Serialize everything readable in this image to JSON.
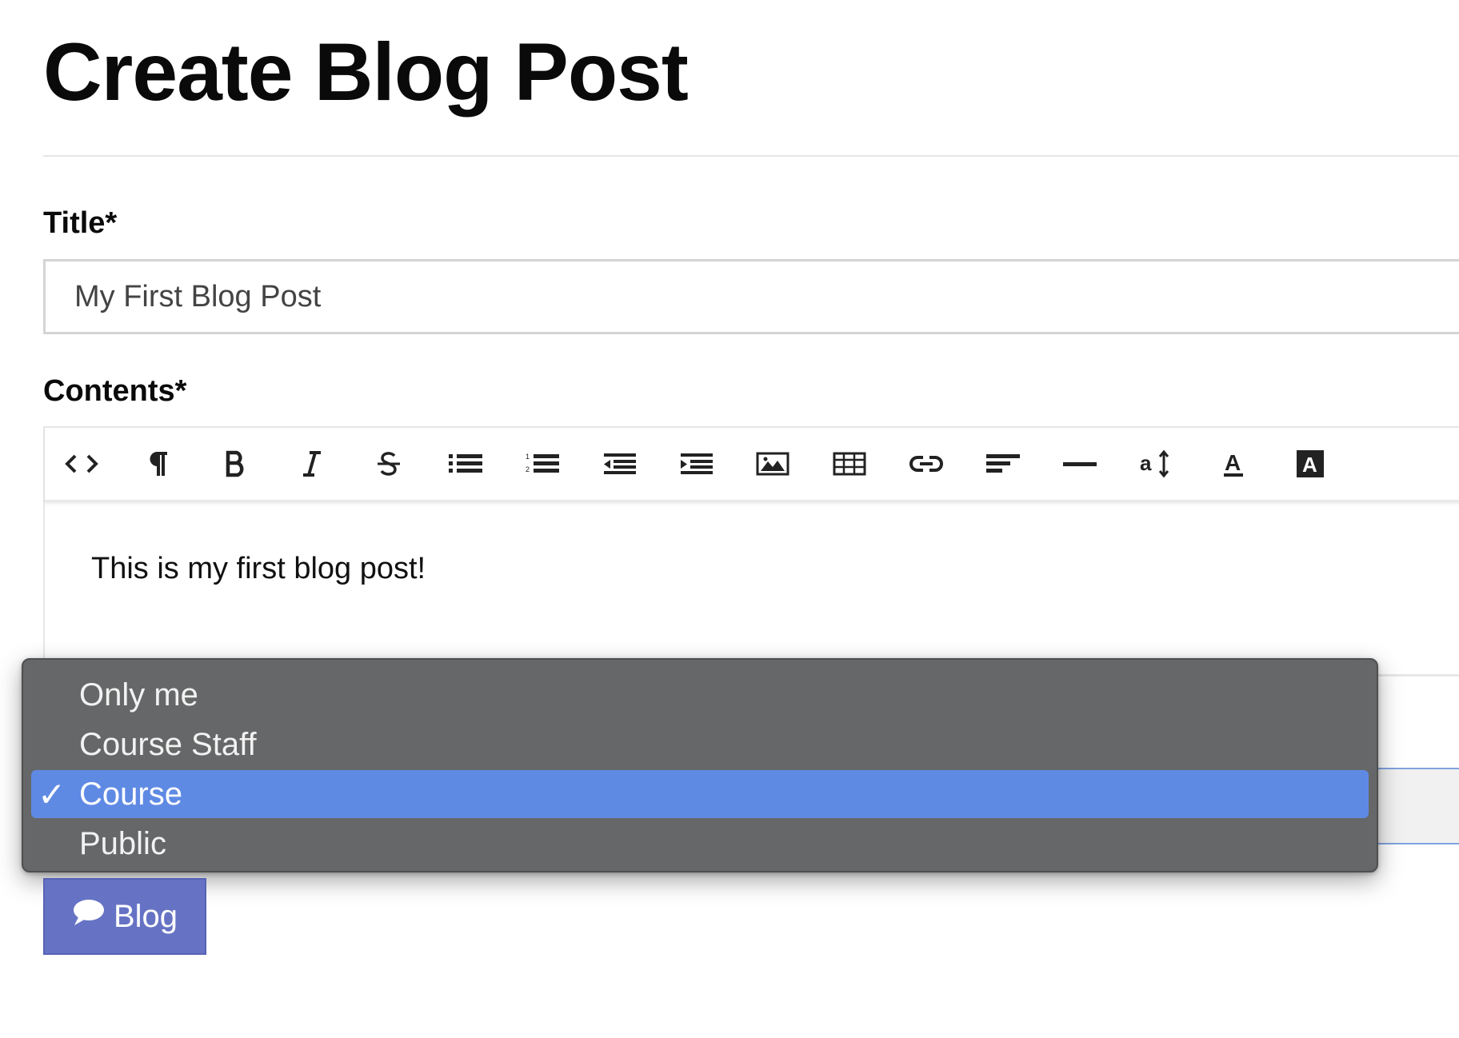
{
  "page": {
    "title": "Create Blog Post"
  },
  "title_field": {
    "label": "Title*",
    "value": "My First Blog Post"
  },
  "contents_field": {
    "label": "Contents*",
    "body": "This is my first blog post!",
    "toolbar": [
      {
        "icon": "code-view-icon",
        "glyph": "<>"
      },
      {
        "icon": "paragraph-icon",
        "glyph": "¶"
      },
      {
        "icon": "bold-icon",
        "glyph": "B"
      },
      {
        "icon": "italic-icon",
        "glyph": "I"
      },
      {
        "icon": "strikethrough-icon",
        "glyph": "S"
      },
      {
        "icon": "bullet-list-icon"
      },
      {
        "icon": "numbered-list-icon"
      },
      {
        "icon": "outdent-icon"
      },
      {
        "icon": "indent-icon"
      },
      {
        "icon": "image-icon"
      },
      {
        "icon": "table-icon"
      },
      {
        "icon": "link-icon"
      },
      {
        "icon": "align-icon"
      },
      {
        "icon": "horizontal-rule-icon"
      },
      {
        "icon": "font-size-icon",
        "glyph": "a"
      },
      {
        "icon": "font-color-icon",
        "glyph": "A"
      },
      {
        "icon": "highlight-color-icon",
        "glyph": "A"
      }
    ]
  },
  "visibility_dropdown": {
    "options": [
      "Only me",
      "Course Staff",
      "Course",
      "Public"
    ],
    "selected": "Course",
    "check_glyph": "✓",
    "selected_color": "#5f8ae4",
    "menu_color": "#666768"
  },
  "submit": {
    "label": "Blog",
    "icon": "speech-bubble-icon",
    "color": "#6673c4"
  }
}
